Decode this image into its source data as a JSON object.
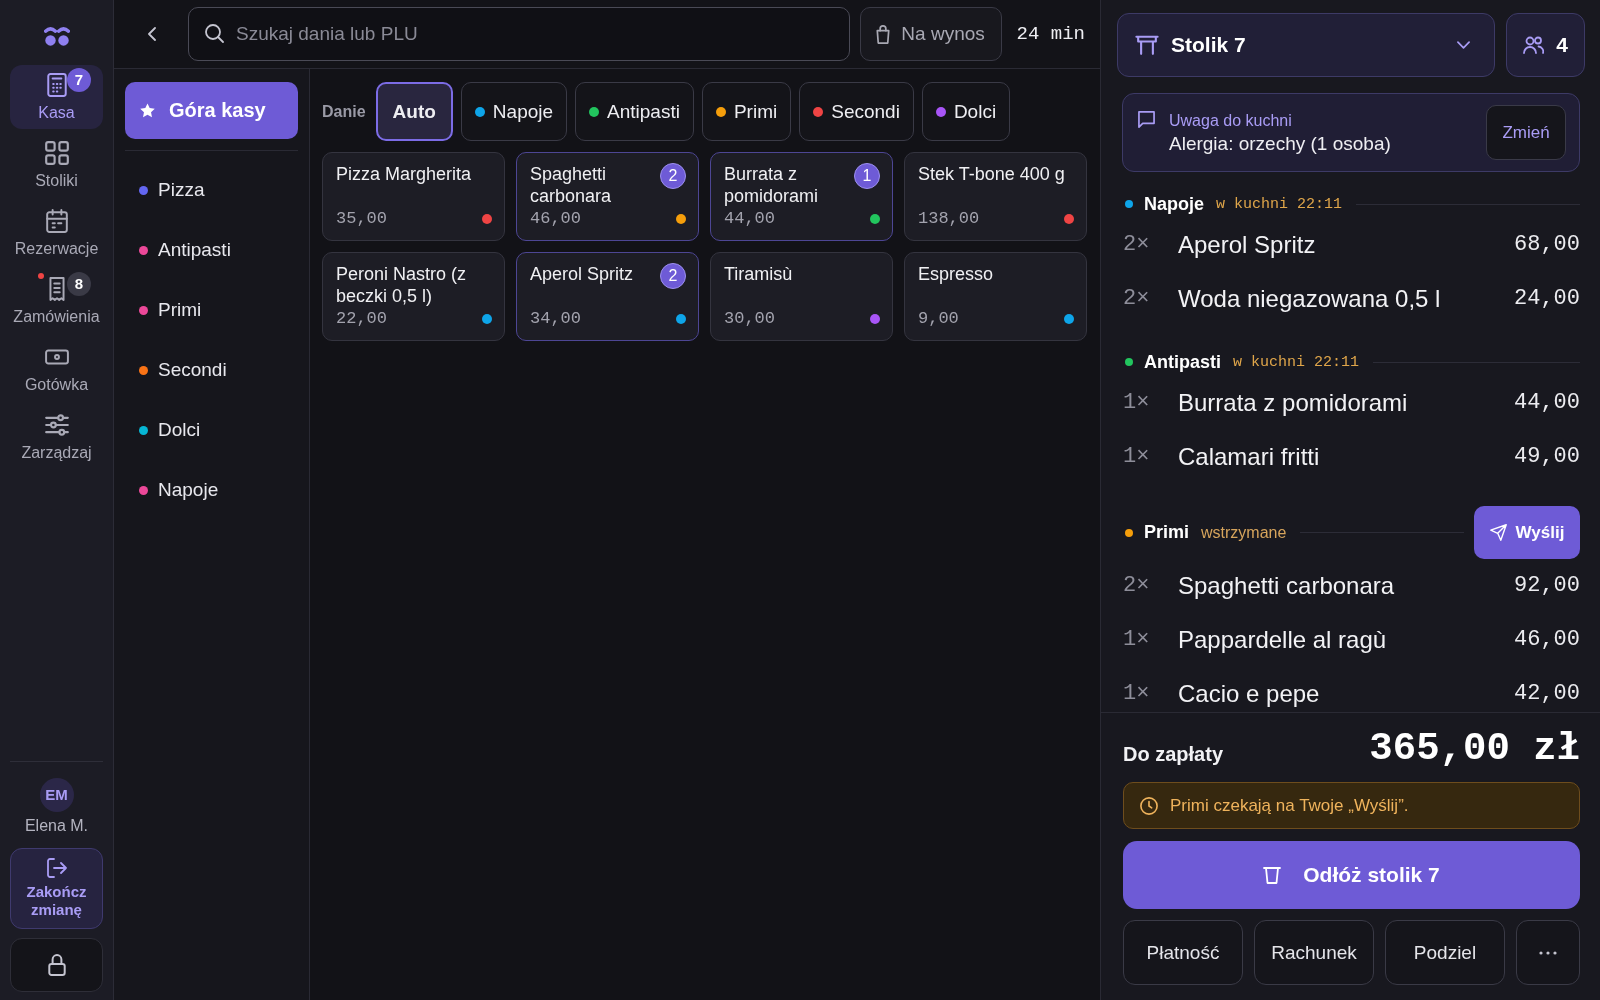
{
  "nav_rail": {
    "items": [
      {
        "label": "Kasa",
        "selected": true,
        "badge": "7",
        "alert": false
      },
      {
        "label": "Stoliki",
        "selected": false,
        "alert": false
      },
      {
        "label": "Rezerwacje",
        "selected": false,
        "alert": false
      },
      {
        "label": "Zamówienia",
        "selected": false,
        "badge": "8",
        "alert": true
      },
      {
        "label": "Gotówka",
        "selected": false,
        "alert": false
      },
      {
        "label": "Zarządzaj",
        "selected": false,
        "alert": false
      }
    ],
    "user": {
      "initials": "EM",
      "name": "Elena M."
    },
    "end_shift_button": "Zakończ zmianę"
  },
  "top_bar": {
    "search": {
      "placeholder": "Szukaj dania lub PLU"
    },
    "takeaway_button": "Na wynos",
    "timer": "24 min"
  },
  "categories": {
    "top_button": {
      "label": "Góra kasy",
      "selected": true
    },
    "items": [
      {
        "label": "Pizza",
        "color": "#6366f1",
        "selected": false
      },
      {
        "label": "Antipasti",
        "color": "#ec4899",
        "selected": false
      },
      {
        "label": "Primi",
        "color": "#ec4899",
        "selected": false
      },
      {
        "label": "Secondi",
        "color": "#f97316",
        "selected": false
      },
      {
        "label": "Dolci",
        "color": "#06b6d4",
        "selected": false
      },
      {
        "label": "Napoje",
        "color": "#ec4899",
        "selected": false
      }
    ]
  },
  "filters": {
    "label": "Danie",
    "chips": [
      {
        "label": "Auto",
        "selected": true
      },
      {
        "label": "Napoje",
        "color": "#0ea5e9",
        "selected": false
      },
      {
        "label": "Antipasti",
        "color": "#22c55e",
        "selected": false
      },
      {
        "label": "Primi",
        "color": "#f59e0b",
        "selected": false
      },
      {
        "label": "Secondi",
        "color": "#ef4444",
        "selected": false
      },
      {
        "label": "Dolci",
        "color": "#a855f7",
        "selected": false
      }
    ]
  },
  "products": [
    {
      "name": "Pizza Margherita",
      "price": "35,00",
      "color": "#ef4444"
    },
    {
      "name": "Spaghetti carbonara",
      "price": "46,00",
      "color": "#f59e0b",
      "count": "2"
    },
    {
      "name": "Burrata z pomidorami",
      "price": "44,00",
      "color": "#22c55e",
      "count": "1"
    },
    {
      "name": "Stek T-bone 400 g",
      "price": "138,00",
      "color": "#ef4444"
    },
    {
      "name": "Peroni Nastro (z beczki 0,5 l)",
      "price": "22,00",
      "color": "#0ea5e9"
    },
    {
      "name": "Aperol Spritz",
      "price": "34,00",
      "color": "#0ea5e9",
      "count": "2"
    },
    {
      "name": "Tiramisù",
      "price": "30,00",
      "color": "#a855f7"
    },
    {
      "name": "Espresso",
      "price": "9,00",
      "color": "#0ea5e9"
    }
  ],
  "order": {
    "table": "Stolik 7",
    "guests": "4",
    "note": {
      "title": "Uwaga do kuchni",
      "text": "Alergia: orzechy (1 osoba)",
      "button": "Zmień"
    },
    "sections": [
      {
        "name": "Napoje",
        "color": "#0ea5e9",
        "kind": "sent",
        "status": "w kuchni 22:11",
        "items": [
          {
            "qty": "2×",
            "name": "Aperol Spritz",
            "price": "68,00"
          },
          {
            "qty": "2×",
            "name": "Woda niegazowana 0,5 l",
            "price": "24,00"
          }
        ]
      },
      {
        "name": "Antipasti",
        "color": "#22c55e",
        "kind": "sent",
        "status": "w kuchni 22:11",
        "items": [
          {
            "qty": "1×",
            "name": "Burrata z pomidorami",
            "price": "44,00"
          },
          {
            "qty": "1×",
            "name": "Calamari fritti",
            "price": "49,00"
          }
        ]
      },
      {
        "name": "Primi",
        "color": "#f59e0b",
        "kind": "held",
        "status": "wstrzymane",
        "send_button": "Wyślij",
        "items": [
          {
            "qty": "2×",
            "name": "Spaghetti carbonara",
            "price": "92,00"
          },
          {
            "qty": "1×",
            "name": "Pappardelle al ragù",
            "price": "46,00"
          },
          {
            "qty": "1×",
            "name": "Cacio e pepe",
            "price": "42,00"
          }
        ]
      }
    ],
    "total_label": "Do zapłaty",
    "total": "365,00 zł",
    "warning": "Primi czekają na Twoje „Wyślij”.",
    "primary_button": "Odłóż stolik 7",
    "actions": [
      {
        "kind": "text",
        "label": "Płatność"
      },
      {
        "kind": "text",
        "label": "Rachunek"
      },
      {
        "kind": "text",
        "label": "Podziel"
      },
      {
        "kind": "more"
      }
    ]
  }
}
